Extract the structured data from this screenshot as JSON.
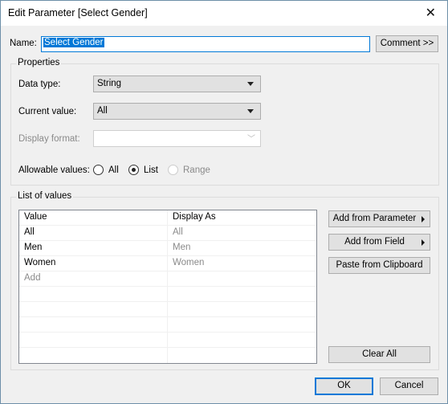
{
  "window": {
    "title": "Edit Parameter [Select Gender]",
    "close_icon": "close-icon"
  },
  "name_row": {
    "label": "Name:",
    "value": "Select Gender",
    "comment_button": "Comment >>"
  },
  "properties": {
    "group_title": "Properties",
    "data_type": {
      "label": "Data type:",
      "value": "String"
    },
    "current_value": {
      "label": "Current value:",
      "value": "All"
    },
    "display_format": {
      "label": "Display format:",
      "value": ""
    },
    "allowable_values": {
      "label": "Allowable values:",
      "options": [
        {
          "label": "All",
          "selected": false,
          "enabled": true
        },
        {
          "label": "List",
          "selected": true,
          "enabled": true
        },
        {
          "label": "Range",
          "selected": false,
          "enabled": false
        }
      ]
    }
  },
  "list_of_values": {
    "group_title": "List of values",
    "columns": [
      "Value",
      "Display As"
    ],
    "rows": [
      {
        "value": "All",
        "display": "All"
      },
      {
        "value": "Men",
        "display": "Men"
      },
      {
        "value": "Women",
        "display": "Women"
      }
    ],
    "add_placeholder": "Add",
    "buttons": {
      "add_from_parameter": "Add from Parameter",
      "add_from_field": "Add from Field",
      "paste_from_clipboard": "Paste from Clipboard",
      "clear_all": "Clear All"
    }
  },
  "footer": {
    "ok": "OK",
    "cancel": "Cancel"
  }
}
